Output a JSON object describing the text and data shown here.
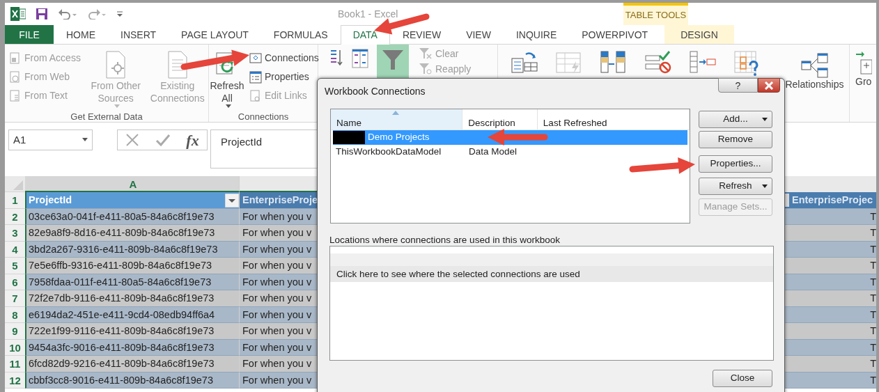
{
  "window": {
    "title": "Book1 - Excel",
    "context_group": "TABLE TOOLS"
  },
  "ribbon_tabs": [
    {
      "label": "FILE",
      "kind": "file",
      "selected": false
    },
    {
      "label": "HOME",
      "kind": "tab",
      "selected": false
    },
    {
      "label": "INSERT",
      "kind": "tab",
      "selected": false
    },
    {
      "label": "PAGE LAYOUT",
      "kind": "tab",
      "selected": false
    },
    {
      "label": "FORMULAS",
      "kind": "tab",
      "selected": false
    },
    {
      "label": "DATA",
      "kind": "tab",
      "selected": true
    },
    {
      "label": "REVIEW",
      "kind": "tab",
      "selected": false
    },
    {
      "label": "VIEW",
      "kind": "tab",
      "selected": false
    },
    {
      "label": "INQUIRE",
      "kind": "tab",
      "selected": false
    },
    {
      "label": "POWERPIVOT",
      "kind": "tab",
      "selected": false
    },
    {
      "label": "DESIGN",
      "kind": "context",
      "selected": false
    }
  ],
  "ribbon_groups": [
    {
      "label": "Get External Data",
      "commands": [
        {
          "kind": "stack",
          "items": [
            {
              "label": "From Access",
              "disabled": true
            },
            {
              "label": "From Web",
              "disabled": true
            },
            {
              "label": "From Text",
              "disabled": true
            }
          ]
        },
        {
          "kind": "large",
          "label": "From Other Sources",
          "has_menu": true,
          "disabled": true
        },
        {
          "kind": "large",
          "label": "Existing Connections",
          "has_menu": false,
          "disabled": true
        }
      ]
    },
    {
      "label": "Connections",
      "commands": [
        {
          "kind": "large",
          "label": "Refresh All",
          "has_menu": true,
          "disabled": false
        },
        {
          "kind": "stack",
          "items": [
            {
              "label": "Connections",
              "disabled": false
            },
            {
              "label": "Properties",
              "disabled": false
            },
            {
              "label": "Edit Links",
              "disabled": true
            }
          ]
        }
      ]
    }
  ],
  "sort_filter": {
    "filter_on": true,
    "commands": [
      {
        "label": "Clear",
        "disabled": true
      },
      {
        "label": "Reapply",
        "disabled": true
      }
    ]
  },
  "relationships": {
    "label": "Relationships"
  },
  "group_button": {
    "label": "Gro"
  },
  "formula_bar": {
    "name_box": "A1",
    "function_button": "fx",
    "formula": "ProjectId"
  },
  "sheet": {
    "columns": [
      {
        "label": "A",
        "selected": true
      }
    ],
    "header": {
      "column_a": "ProjectId",
      "column_b": "EnterpriseProje",
      "column_right": "EnterpriseProjec"
    },
    "rows": [
      {
        "number": "1",
        "header": true
      },
      {
        "number": "2",
        "column_a": "03ce63a0-041f-e411-80a5-84a6c8f19e73",
        "column_b": "For when you v",
        "column_right": "T"
      },
      {
        "number": "3",
        "column_a": "82e9a8f9-8d16-e411-809b-84a6c8f19e73",
        "column_b": "For when you v",
        "column_right": "T"
      },
      {
        "number": "4",
        "column_a": "3bd2a267-9316-e411-809b-84a6c8f19e73",
        "column_b": "For when you v",
        "column_right": "T"
      },
      {
        "number": "5",
        "column_a": "7e5e6ffb-9316-e411-809b-84a6c8f19e73",
        "column_b": "For when you v",
        "column_right": "T"
      },
      {
        "number": "6",
        "column_a": "7958fdaa-011f-e411-80a5-84a6c8f19e73",
        "column_b": "For when you v",
        "column_right": "T"
      },
      {
        "number": "7",
        "column_a": "72f2e7db-9116-e411-809b-84a6c8f19e73",
        "column_b": "For when you v",
        "column_right": "T"
      },
      {
        "number": "8",
        "column_a": "e6194da2-451e-e411-9cd4-08edb94ff6a4",
        "column_b": "For when you v",
        "column_right": "T"
      },
      {
        "number": "9",
        "column_a": "722e1f99-9116-e411-809b-84a6c8f19e73",
        "column_b": "For when you v",
        "column_right": "T"
      },
      {
        "number": "10",
        "column_a": "9454a3fc-9016-e411-809b-84a6c8f19e73",
        "column_b": "For when you v",
        "column_right": "T"
      },
      {
        "number": "11",
        "column_a": "6fcd82d9-9216-e411-809b-84a6c8f19e73",
        "column_b": "For when you v",
        "column_right": "T"
      },
      {
        "number": "12",
        "column_a": "cbbf3cc8-9016-e411-809b-84a6c8f19e73",
        "column_b": "For when you v",
        "column_right": "T"
      }
    ]
  },
  "dialog": {
    "title": "Workbook Connections",
    "help": "?",
    "columns": [
      {
        "label": "Name",
        "sorted": true
      },
      {
        "label": "Description",
        "sorted": false
      },
      {
        "label": "Last Refreshed",
        "sorted": false
      }
    ],
    "connections": [
      {
        "name": "Demo Projects",
        "redacted": true,
        "selected": true
      },
      {
        "name": "ThisWorkbookDataModel",
        "description": "Data Model",
        "redacted": false,
        "selected": false
      }
    ],
    "buttons": [
      {
        "label": "Add...",
        "has_menu": true,
        "disabled": false
      },
      {
        "label": "Remove",
        "has_menu": false,
        "disabled": false
      },
      {
        "label": "Properties...",
        "has_menu": false,
        "disabled": false
      },
      {
        "label": "Refresh",
        "has_menu": true,
        "disabled": false
      },
      {
        "label": "Manage Sets...",
        "has_menu": false,
        "disabled": true
      }
    ],
    "locations_label": "Locations where connections are used in this workbook",
    "locations_hint": "Click here to see where the selected connections are used",
    "close_button": "Close"
  }
}
